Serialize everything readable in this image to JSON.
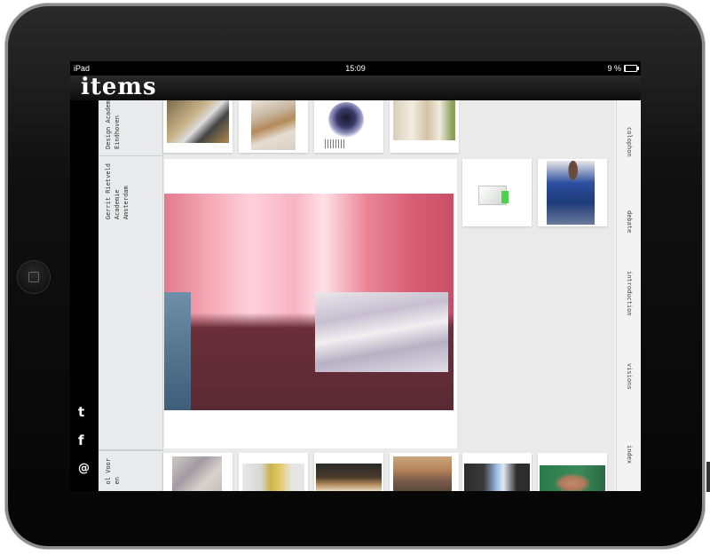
{
  "statusbar": {
    "device": "iPad",
    "time": "15:09",
    "battery_text": "9 %",
    "battery_level_percent": 9
  },
  "app": {
    "logo": "items"
  },
  "social": {
    "twitter": "t",
    "facebook": "f",
    "email": "@"
  },
  "schools": [
    {
      "name": "Design Academy\nEindhoven"
    },
    {
      "name": "Gerrit Rietveld\nAcademie\nAmsterdam"
    },
    {
      "name": "ol Voor\nen"
    }
  ],
  "nav": [
    {
      "label": "colophon"
    },
    {
      "label": "debate"
    },
    {
      "label": "introduction"
    },
    {
      "label": "visions"
    },
    {
      "label": "index"
    }
  ],
  "thumbnails": {
    "top_row": [
      "workshop-photo",
      "wood-frame-photo",
      "dark-drop-print",
      "cardboard-model-photo"
    ],
    "middle_right": [
      "green-white-model-render",
      "person-in-blue-photo"
    ],
    "bottom_row": [
      "poster-wall-photo",
      "yellow-card-photo",
      "stage-lights-photo",
      "street-buildings-photo",
      "laptop-desk-photo",
      "woman-smiling-photo"
    ],
    "featured": "pink-room-photo"
  }
}
